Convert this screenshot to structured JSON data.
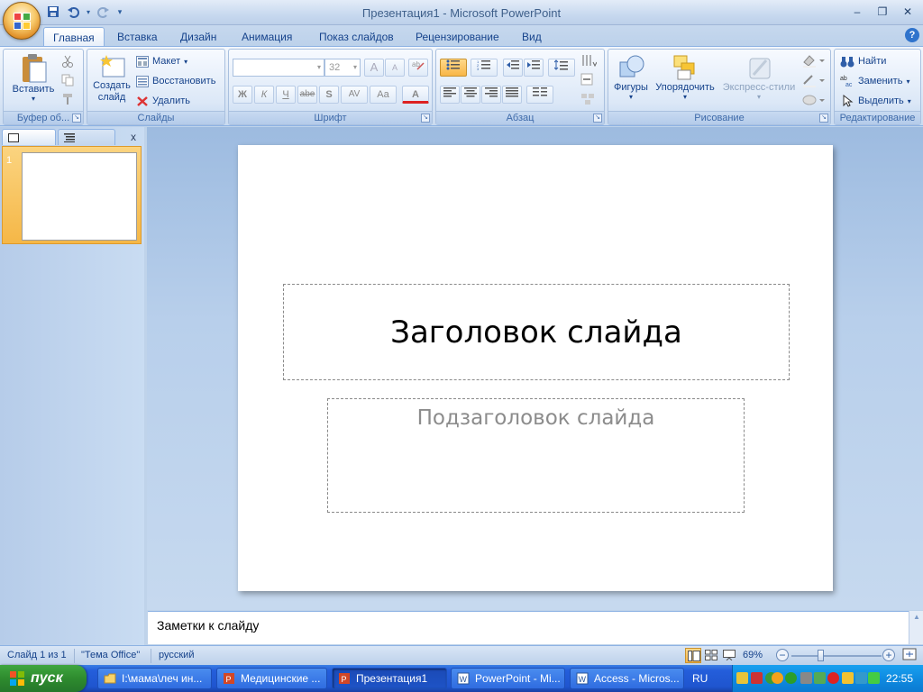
{
  "window": {
    "title": "Презентация1 - Microsoft PowerPoint",
    "minimize": "–",
    "restore": "❐",
    "close": "✕"
  },
  "qat": {
    "save_icon": "save-icon",
    "undo_icon": "undo-icon",
    "redo_icon": "redo-icon",
    "customize_icon": "dropdown-arrow-icon"
  },
  "tabs": [
    "Главная",
    "Вставка",
    "Дизайн",
    "Анимация",
    "Показ слайдов",
    "Рецензирование",
    "Вид"
  ],
  "help": "?",
  "ribbon": {
    "clipboard": {
      "label": "Буфер об...",
      "paste": "Вставить"
    },
    "slides": {
      "label": "Слайды",
      "new_slide": "Создать слайд",
      "layout": "Макет",
      "reset": "Восстановить",
      "delete": "Удалить"
    },
    "font": {
      "label": "Шрифт",
      "font_size": "32",
      "font_name": "",
      "bold": "Ж",
      "italic": "К",
      "underline": "Ч",
      "strike": "abe",
      "shadow": "S",
      "spacing": "AV",
      "case": "Aa",
      "color": "A",
      "grow": "A",
      "shrink": "A"
    },
    "paragraph": {
      "label": "Абзац"
    },
    "drawing": {
      "label": "Рисование",
      "shapes": "Фигуры",
      "arrange": "Упорядочить",
      "quick_styles": "Экспресс-стили"
    },
    "editing": {
      "label": "Редактирование",
      "find": "Найти",
      "replace": "Заменить",
      "select": "Выделить"
    }
  },
  "panel": {
    "close": "x",
    "slide_number": "1"
  },
  "slide": {
    "title": "Заголовок слайда",
    "subtitle": "Подзаголовок слайда"
  },
  "notes": {
    "placeholder": "Заметки к слайду"
  },
  "status": {
    "slide_info": "Слайд 1 из 1",
    "theme": "\"Тема Office\"",
    "language": "русский",
    "zoom": "69%"
  },
  "taskbar": {
    "start": "пуск",
    "items": [
      {
        "label": "I:\\мама\\леч ин...",
        "icon": "folder-icon",
        "active": false
      },
      {
        "label": "Медицинские ...",
        "icon": "powerpoint-icon",
        "active": false
      },
      {
        "label": "Презентация1",
        "icon": "powerpoint-icon",
        "active": true
      },
      {
        "label": "PowerPoint - Mi...",
        "icon": "word-icon",
        "active": false
      },
      {
        "label": "Access - Micros...",
        "icon": "word-icon",
        "active": false
      }
    ],
    "language": "RU",
    "clock": "22:55"
  },
  "colors": {
    "accent": "#15428b",
    "ribbon_bg": "#dbe7f6",
    "selected_thumb": "#f5b747",
    "taskbar": "#245edb",
    "start": "#2e8b2e"
  }
}
